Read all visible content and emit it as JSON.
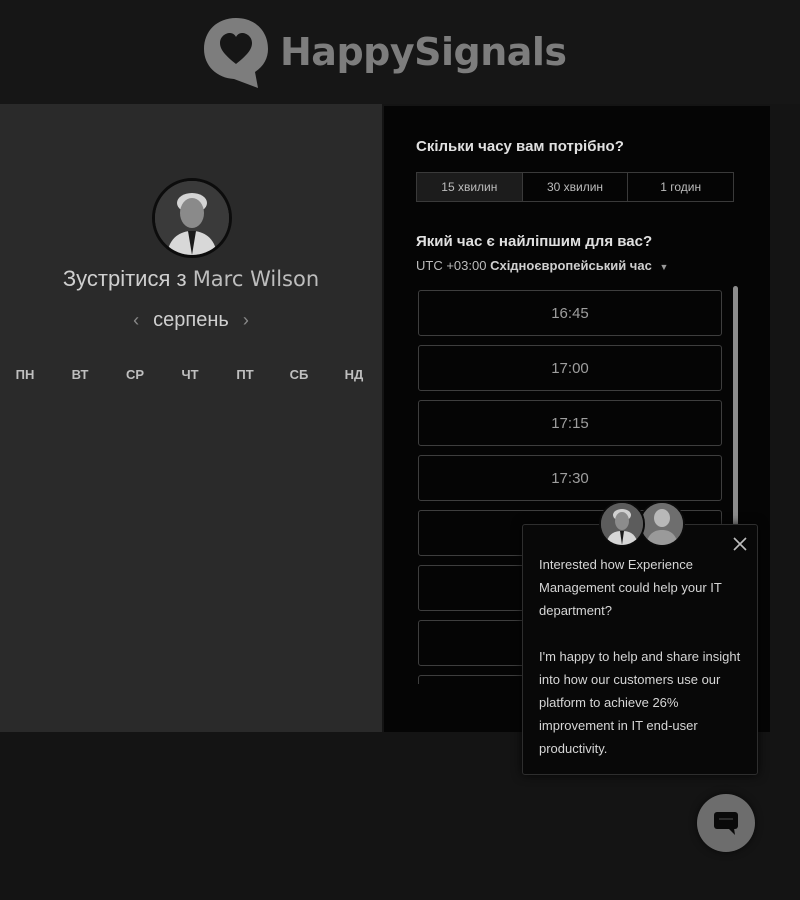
{
  "brand": {
    "name": "HappySignals",
    "logo_icon": "heart-speech-bubble-icon"
  },
  "scheduler": {
    "title_prefix": "Зустрітися з",
    "host_name": "Marc Wilson",
    "month": "серпень",
    "weekdays": [
      "ПН",
      "ВТ",
      "СР",
      "ЧТ",
      "ПТ",
      "СБ",
      "НД"
    ]
  },
  "booking": {
    "duration_question": "Скільки часу вам потрібно?",
    "durations": [
      "15 хвилин",
      "30 хвилин",
      "1 годин"
    ],
    "selected_duration": "15 хвилин",
    "time_question": "Який час є найліпшим для вас?",
    "timezone_offset": "UTC +03:00",
    "timezone_name": "Східноєвропейський час",
    "slots": [
      "16:45",
      "17:00",
      "17:15",
      "17:30",
      "",
      "",
      "",
      ""
    ]
  },
  "chat": {
    "message_1": "Interested how Experience Management could help your IT department?",
    "message_2": "I'm happy to help and share insight into how our customers use our platform to achieve 26% improvement in IT end-user productivity.",
    "close_icon": "close-icon",
    "launcher_icon": "chat-bubble-icon"
  }
}
